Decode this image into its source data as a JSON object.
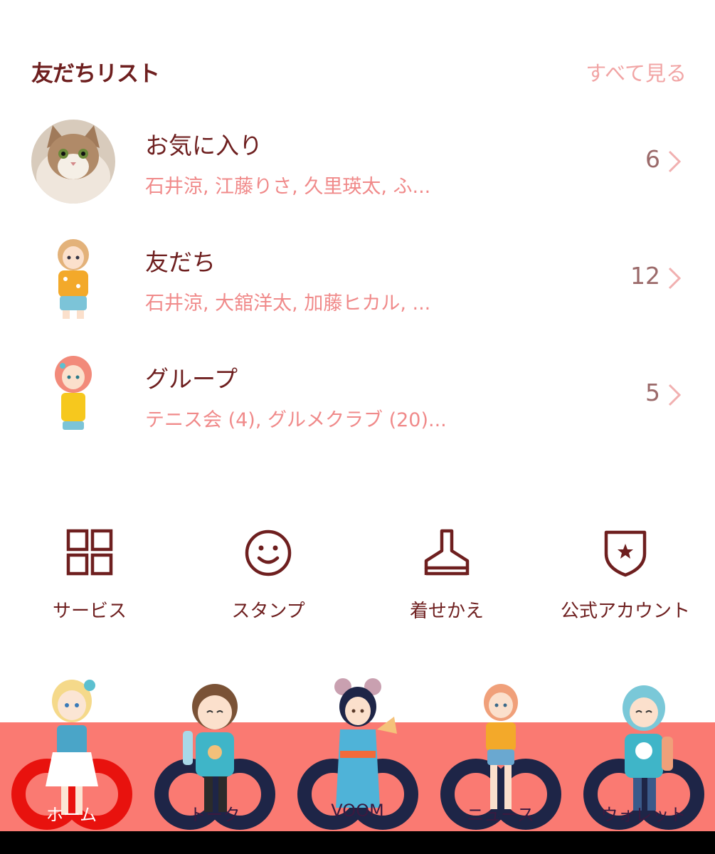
{
  "header": {
    "title": "友だちリスト",
    "see_all": "すべて見る"
  },
  "groups": [
    {
      "title": "お気に入り",
      "members": "石井涼, 江藤りさ, 久里瑛太, ふ...",
      "count": "6",
      "avatar": "cat-photo-avatar"
    },
    {
      "title": "友だち",
      "members": "石井涼, 大舘洋太, 加藤ヒカル, ...",
      "count": "12",
      "avatar": "girl-yellow-shirt-avatar"
    },
    {
      "title": "グループ",
      "members": "テニス会 (4), グルメクラブ (20)...",
      "count": "5",
      "avatar": "girl-pink-hair-avatar"
    }
  ],
  "shortcuts": [
    {
      "label": "サービス",
      "icon": "grid-icon"
    },
    {
      "label": "スタンプ",
      "icon": "smiley-icon"
    },
    {
      "label": "着せかえ",
      "icon": "brush-icon"
    },
    {
      "label": "公式アカウント",
      "icon": "shield-star-icon"
    }
  ],
  "tabs": [
    {
      "label": "ホーム",
      "active": true
    },
    {
      "label": "トーク",
      "active": false
    },
    {
      "label": "VOOM",
      "active": false
    },
    {
      "label": "ニュース",
      "active": false
    },
    {
      "label": "ウォレット",
      "active": false
    }
  ],
  "colors": {
    "text_dark": "#6e1f1f",
    "text_pink": "#f08a8a",
    "see_all": "#f1a4a4",
    "tabbar": "#fa7a72",
    "ring_active": "#e8120e",
    "ring_inactive": "#1e2547"
  }
}
